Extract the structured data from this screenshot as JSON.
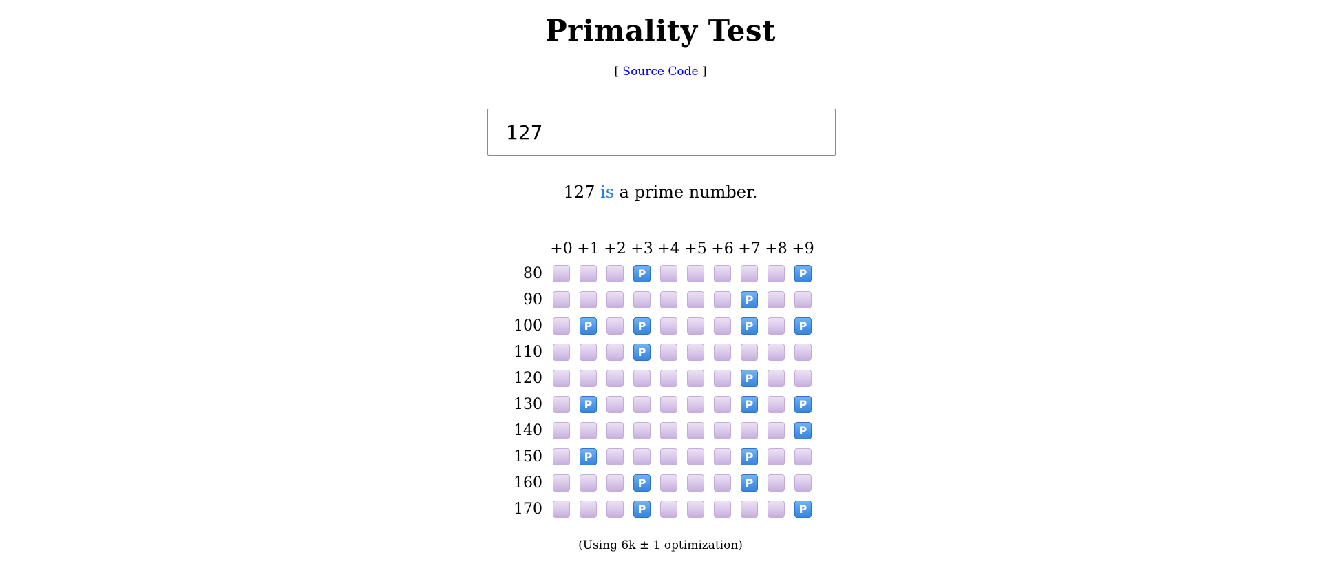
{
  "page": {
    "title": "Primality Test",
    "source_prefix": "[",
    "source_link": "Source Code",
    "source_suffix": "]"
  },
  "input": {
    "value": "127"
  },
  "result": {
    "number": "127",
    "is_word": "is",
    "rest": "a prime number."
  },
  "grid": {
    "columns": [
      "+0",
      "+1",
      "+2",
      "+3",
      "+4",
      "+5",
      "+6",
      "+7",
      "+8",
      "+9"
    ],
    "rows": [
      {
        "label": "80",
        "primes": [
          3,
          9
        ]
      },
      {
        "label": "90",
        "primes": [
          7
        ]
      },
      {
        "label": "100",
        "primes": [
          1,
          3,
          7,
          9
        ]
      },
      {
        "label": "110",
        "primes": [
          3
        ]
      },
      {
        "label": "120",
        "primes": [
          7
        ]
      },
      {
        "label": "130",
        "primes": [
          1,
          7,
          9
        ]
      },
      {
        "label": "140",
        "primes": [
          9
        ]
      },
      {
        "label": "150",
        "primes": [
          1,
          7
        ]
      },
      {
        "label": "160",
        "primes": [
          3,
          7
        ]
      },
      {
        "label": "170",
        "primes": [
          3,
          9
        ]
      }
    ],
    "prime_glyph": "P",
    "prime_color": "#4d97e9",
    "composite_color": "#d9c7ea"
  },
  "footer": {
    "note": "(Using 6k ± 1 optimization)"
  }
}
